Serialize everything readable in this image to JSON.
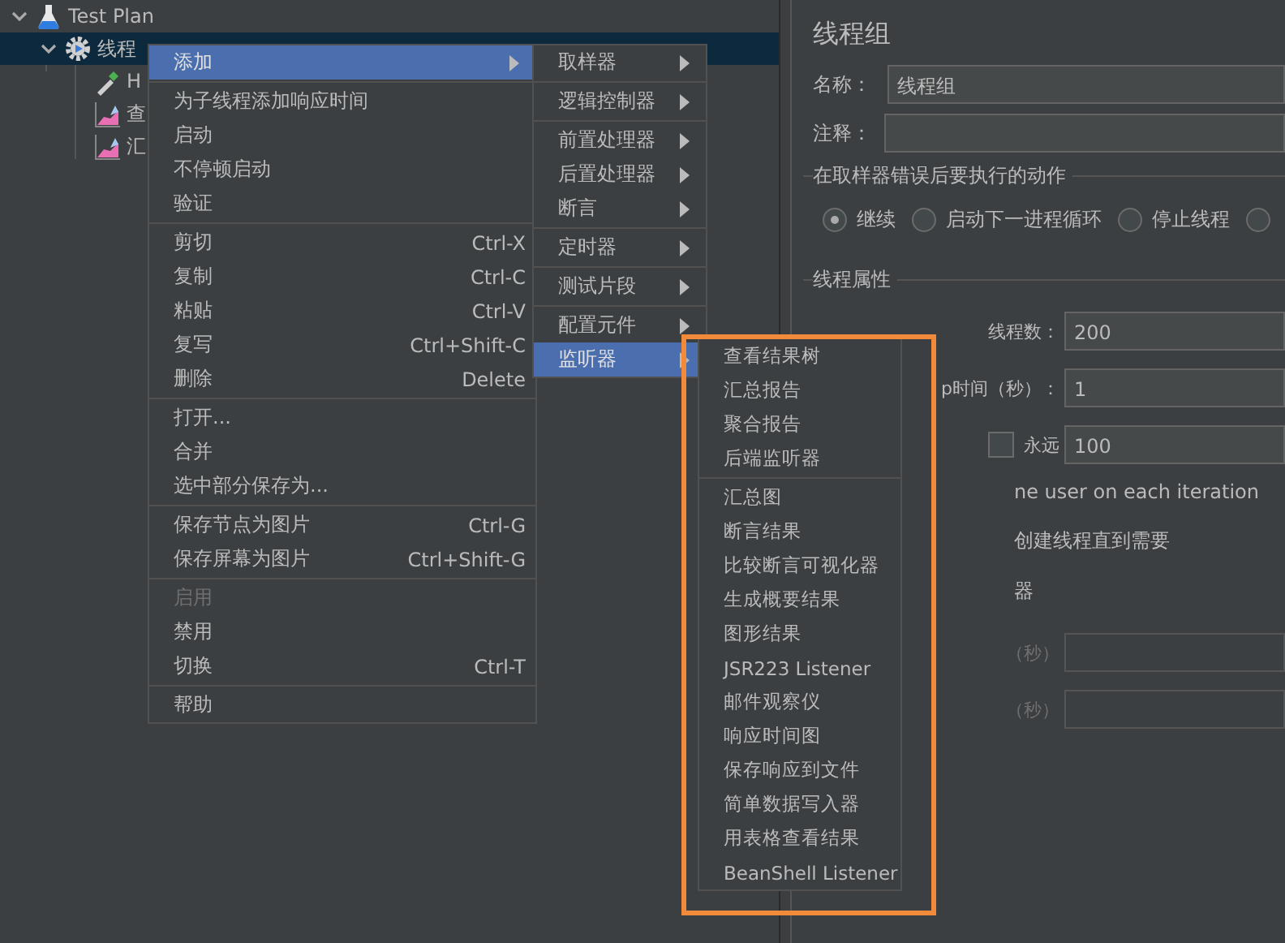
{
  "tree": [
    {
      "label": "Test Plan",
      "kind": "plan",
      "expanded": true,
      "selected": false,
      "children": [
        {
          "label": "线程",
          "kind": "group",
          "expanded": true,
          "selected": true,
          "children": [
            {
              "label": "H",
              "kind": "sampler",
              "selected": false
            },
            {
              "label": "查",
              "kind": "listener",
              "selected": false
            },
            {
              "label": "汇",
              "kind": "listener",
              "selected": false
            }
          ]
        }
      ]
    }
  ],
  "panel": {
    "title": "线程组",
    "name_field": {
      "label": "名称：",
      "value": "线程组"
    },
    "comment_field": {
      "label": "注释："
    },
    "error_group": {
      "legend": "在取样器错误后要执行的动作",
      "options": [
        {
          "label": "继续",
          "selected": true
        },
        {
          "label": "启动下一进程循环",
          "selected": false
        },
        {
          "label": "停止线程",
          "selected": false
        },
        {
          "selected": false
        }
      ]
    },
    "props_group": {
      "legend": "线程属性"
    },
    "rows": [
      {
        "kind": "field",
        "label": "线程数：",
        "value": "200",
        "disabled": false
      },
      {
        "kind": "field",
        "label": "p时间（秒）：",
        "value": "1",
        "disabled": false
      },
      {
        "kind": "checkfield",
        "label": "永远",
        "checked": false,
        "value": "100",
        "disabled": false
      },
      {
        "kind": "text",
        "label": "ne user on each iteration"
      },
      {
        "kind": "text",
        "label": "创建线程直到需要"
      },
      {
        "kind": "text",
        "label": "器"
      },
      {
        "kind": "field",
        "label": "（秒）",
        "disabled": true
      },
      {
        "kind": "field",
        "label": "（秒）",
        "disabled": true
      }
    ]
  },
  "menus": [
    {
      "groups": [
        [
          {
            "label": "添加",
            "submenu": true,
            "selected": true,
            "disabled": false
          }
        ],
        [
          {
            "label": "为子线程添加响应时间",
            "selected": false,
            "disabled": false
          },
          {
            "label": "启动",
            "selected": false,
            "disabled": false
          },
          {
            "label": "不停顿启动",
            "selected": false,
            "disabled": false
          },
          {
            "label": "验证",
            "selected": false,
            "disabled": false
          }
        ],
        [
          {
            "label": "剪切",
            "shortcut": "Ctrl-X",
            "selected": false,
            "disabled": false
          },
          {
            "label": "复制",
            "shortcut": "Ctrl-C",
            "selected": false,
            "disabled": false
          },
          {
            "label": "粘贴",
            "shortcut": "Ctrl-V",
            "selected": false,
            "disabled": false
          },
          {
            "label": "复写",
            "shortcut": "Ctrl+Shift-C",
            "selected": false,
            "disabled": false
          },
          {
            "label": "删除",
            "shortcut": "Delete",
            "selected": false,
            "disabled": false
          }
        ],
        [
          {
            "label": "打开...",
            "selected": false,
            "disabled": false
          },
          {
            "label": "合并",
            "selected": false,
            "disabled": false
          },
          {
            "label": "选中部分保存为...",
            "selected": false,
            "disabled": false
          }
        ],
        [
          {
            "label": "保存节点为图片",
            "shortcut": "Ctrl-G",
            "selected": false,
            "disabled": false
          },
          {
            "label": "保存屏幕为图片",
            "shortcut": "Ctrl+Shift-G",
            "selected": false,
            "disabled": false
          }
        ],
        [
          {
            "label": "启用",
            "selected": false,
            "disabled": true
          },
          {
            "label": "禁用",
            "selected": false,
            "disabled": false
          },
          {
            "label": "切换",
            "shortcut": "Ctrl-T",
            "selected": false,
            "disabled": false
          }
        ],
        [
          {
            "label": "帮助",
            "selected": false,
            "disabled": false
          }
        ]
      ]
    },
    {
      "groups": [
        [
          {
            "label": "取样器",
            "submenu": true,
            "selected": false,
            "disabled": false
          }
        ],
        [
          {
            "label": "逻辑控制器",
            "submenu": true,
            "selected": false,
            "disabled": false
          }
        ],
        [
          {
            "label": "前置处理器",
            "submenu": true,
            "selected": false,
            "disabled": false
          },
          {
            "label": "后置处理器",
            "submenu": true,
            "selected": false,
            "disabled": false
          },
          {
            "label": "断言",
            "submenu": true,
            "selected": false,
            "disabled": false
          }
        ],
        [
          {
            "label": "定时器",
            "submenu": true,
            "selected": false,
            "disabled": false
          }
        ],
        [
          {
            "label": "测试片段",
            "submenu": true,
            "selected": false,
            "disabled": false
          }
        ],
        [
          {
            "label": "配置元件",
            "submenu": true,
            "selected": false,
            "disabled": false
          },
          {
            "label": "监听器",
            "submenu": true,
            "selected": true,
            "disabled": false
          }
        ]
      ]
    },
    {
      "groups": [
        [
          {
            "label": "查看结果树",
            "selected": false,
            "disabled": false
          },
          {
            "label": "汇总报告",
            "selected": false,
            "disabled": false
          },
          {
            "label": "聚合报告",
            "selected": false,
            "disabled": false
          },
          {
            "label": "后端监听器",
            "selected": false,
            "disabled": false
          }
        ],
        [
          {
            "label": "汇总图",
            "selected": false,
            "disabled": false
          },
          {
            "label": "断言结果",
            "selected": false,
            "disabled": false
          },
          {
            "label": "比较断言可视化器",
            "selected": false,
            "disabled": false
          },
          {
            "label": "生成概要结果",
            "selected": false,
            "disabled": false
          },
          {
            "label": "图形结果",
            "selected": false,
            "disabled": false
          },
          {
            "label": "JSR223 Listener",
            "selected": false,
            "disabled": false
          },
          {
            "label": "邮件观察仪",
            "selected": false,
            "disabled": false
          },
          {
            "label": "响应时间图",
            "selected": false,
            "disabled": false
          },
          {
            "label": "保存响应到文件",
            "selected": false,
            "disabled": false
          },
          {
            "label": "简单数据写入器",
            "selected": false,
            "disabled": false
          },
          {
            "label": "用表格查看结果",
            "selected": false,
            "disabled": false
          },
          {
            "label": "BeanShell Listener",
            "selected": false,
            "disabled": false
          }
        ]
      ]
    }
  ],
  "highlight": {
    "on": true
  }
}
